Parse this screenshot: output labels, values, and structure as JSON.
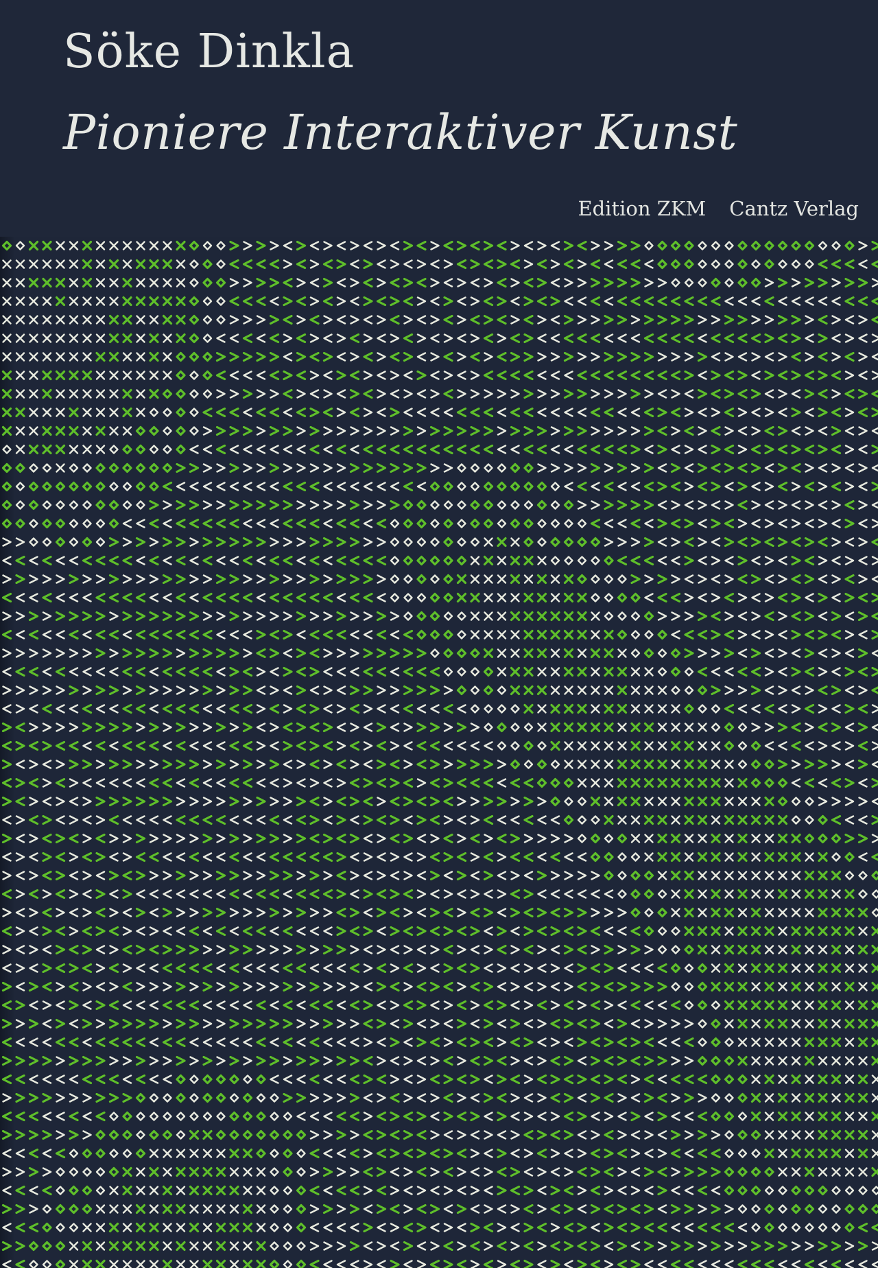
{
  "cover": {
    "author": "Söke Dinkla",
    "title": "Pioniere Interaktiver Kunst",
    "publishers": [
      "Edition ZKM",
      "Cantz Verlag"
    ]
  },
  "colors": {
    "background": "#1e2638",
    "text": "#e6e8e4",
    "pattern_green": "#5fbf2a",
    "pattern_white": "#e8eadf"
  },
  "pattern": {
    "name": "chevron-pattern",
    "glyphs": [
      "<",
      ">",
      "x",
      "◇"
    ]
  }
}
